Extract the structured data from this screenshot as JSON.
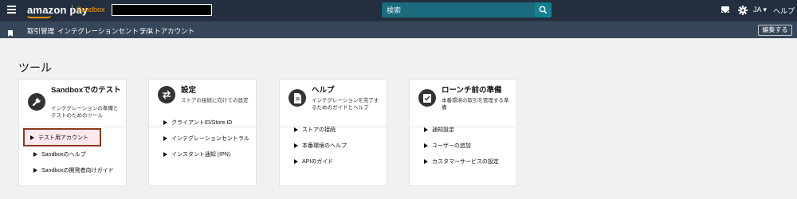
{
  "topbar": {
    "logo_main": "amazon pay",
    "logo_env": "Sandbox",
    "search_placeholder": "検索",
    "lang": "JA ▾",
    "help": "ヘルプ",
    "icons": [
      "menu-icon",
      "search-icon",
      "mail-icon",
      "gear-icon"
    ]
  },
  "subnav": {
    "items": [
      "取引管理",
      "インテグレーションセントラル",
      "テストアカウント"
    ],
    "edit": "編集する"
  },
  "page": {
    "title": "ツール"
  },
  "cards": [
    {
      "title": "Sandboxでのテスト",
      "desc": "インテグレーションの準備とテストのためのツール",
      "icon": "wrench-icon",
      "links": [
        "テスト用アカウント",
        "Sandboxのヘルプ",
        "Sandboxの開発者向けガイド"
      ]
    },
    {
      "title": "設定",
      "desc": "ストアの接続に向けての設定",
      "icon": "arrows-icon",
      "links": [
        "クライアントID/Store ID",
        "インテグレーションセントラル",
        "インスタント通知 (IPN)"
      ]
    },
    {
      "title": "ヘルプ",
      "desc": "インテグレーションを完了するためのガイドとヘルプ",
      "icon": "document-icon",
      "links": [
        "ストアの接続",
        "本番環境のヘルプ",
        "APIのガイド"
      ]
    },
    {
      "title": "ローンチ前の準備",
      "desc": "本番環境の取引を管理する準備",
      "icon": "checklist-icon",
      "links": [
        "通知設定",
        "ユーザーの追加",
        "カスタマーサービスの設定"
      ]
    }
  ],
  "colors": {
    "topbar": "#232f3e",
    "subnav": "#37475a",
    "accent": "#ff9900",
    "search": "#1b6b7e",
    "highlight_border": "#8a3b1a"
  }
}
